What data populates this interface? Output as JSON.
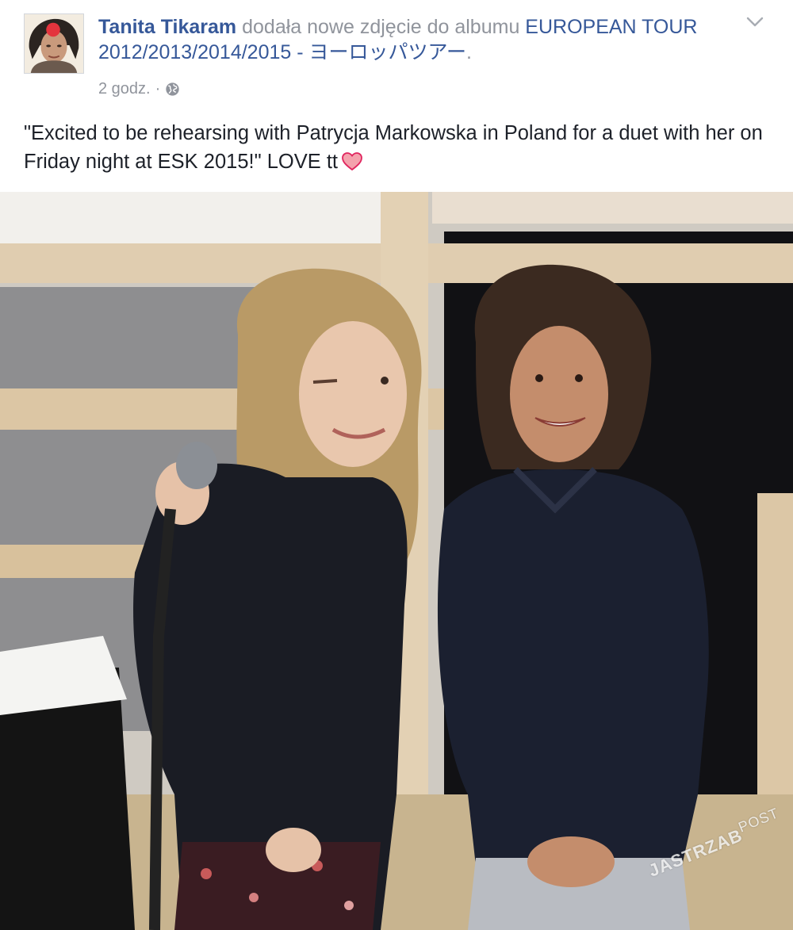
{
  "post": {
    "author": "Tanita Tikaram",
    "action_text": " dodała nowe zdjęcie do albumu ",
    "album_title": "EUROPEAN TOUR 2012/2013/2014/2015 - ヨーロッパツアー",
    "album_suffix": ".",
    "timestamp": "2 godz.",
    "separator": "·",
    "audience_icon": "globe-icon",
    "message": "\"Excited to be rehearsing with Patrycja Markowska in Poland for a duet with her on Friday night at ESK 2015!\" LOVE tt",
    "message_emoji": "heart-icon"
  },
  "photo": {
    "watermark_main": "JASTRZAB",
    "watermark_sub": "POST"
  },
  "colors": {
    "link": "#365899",
    "secondary_text": "#90949c",
    "body_text": "#1d2129",
    "heart": "#e0245e"
  }
}
